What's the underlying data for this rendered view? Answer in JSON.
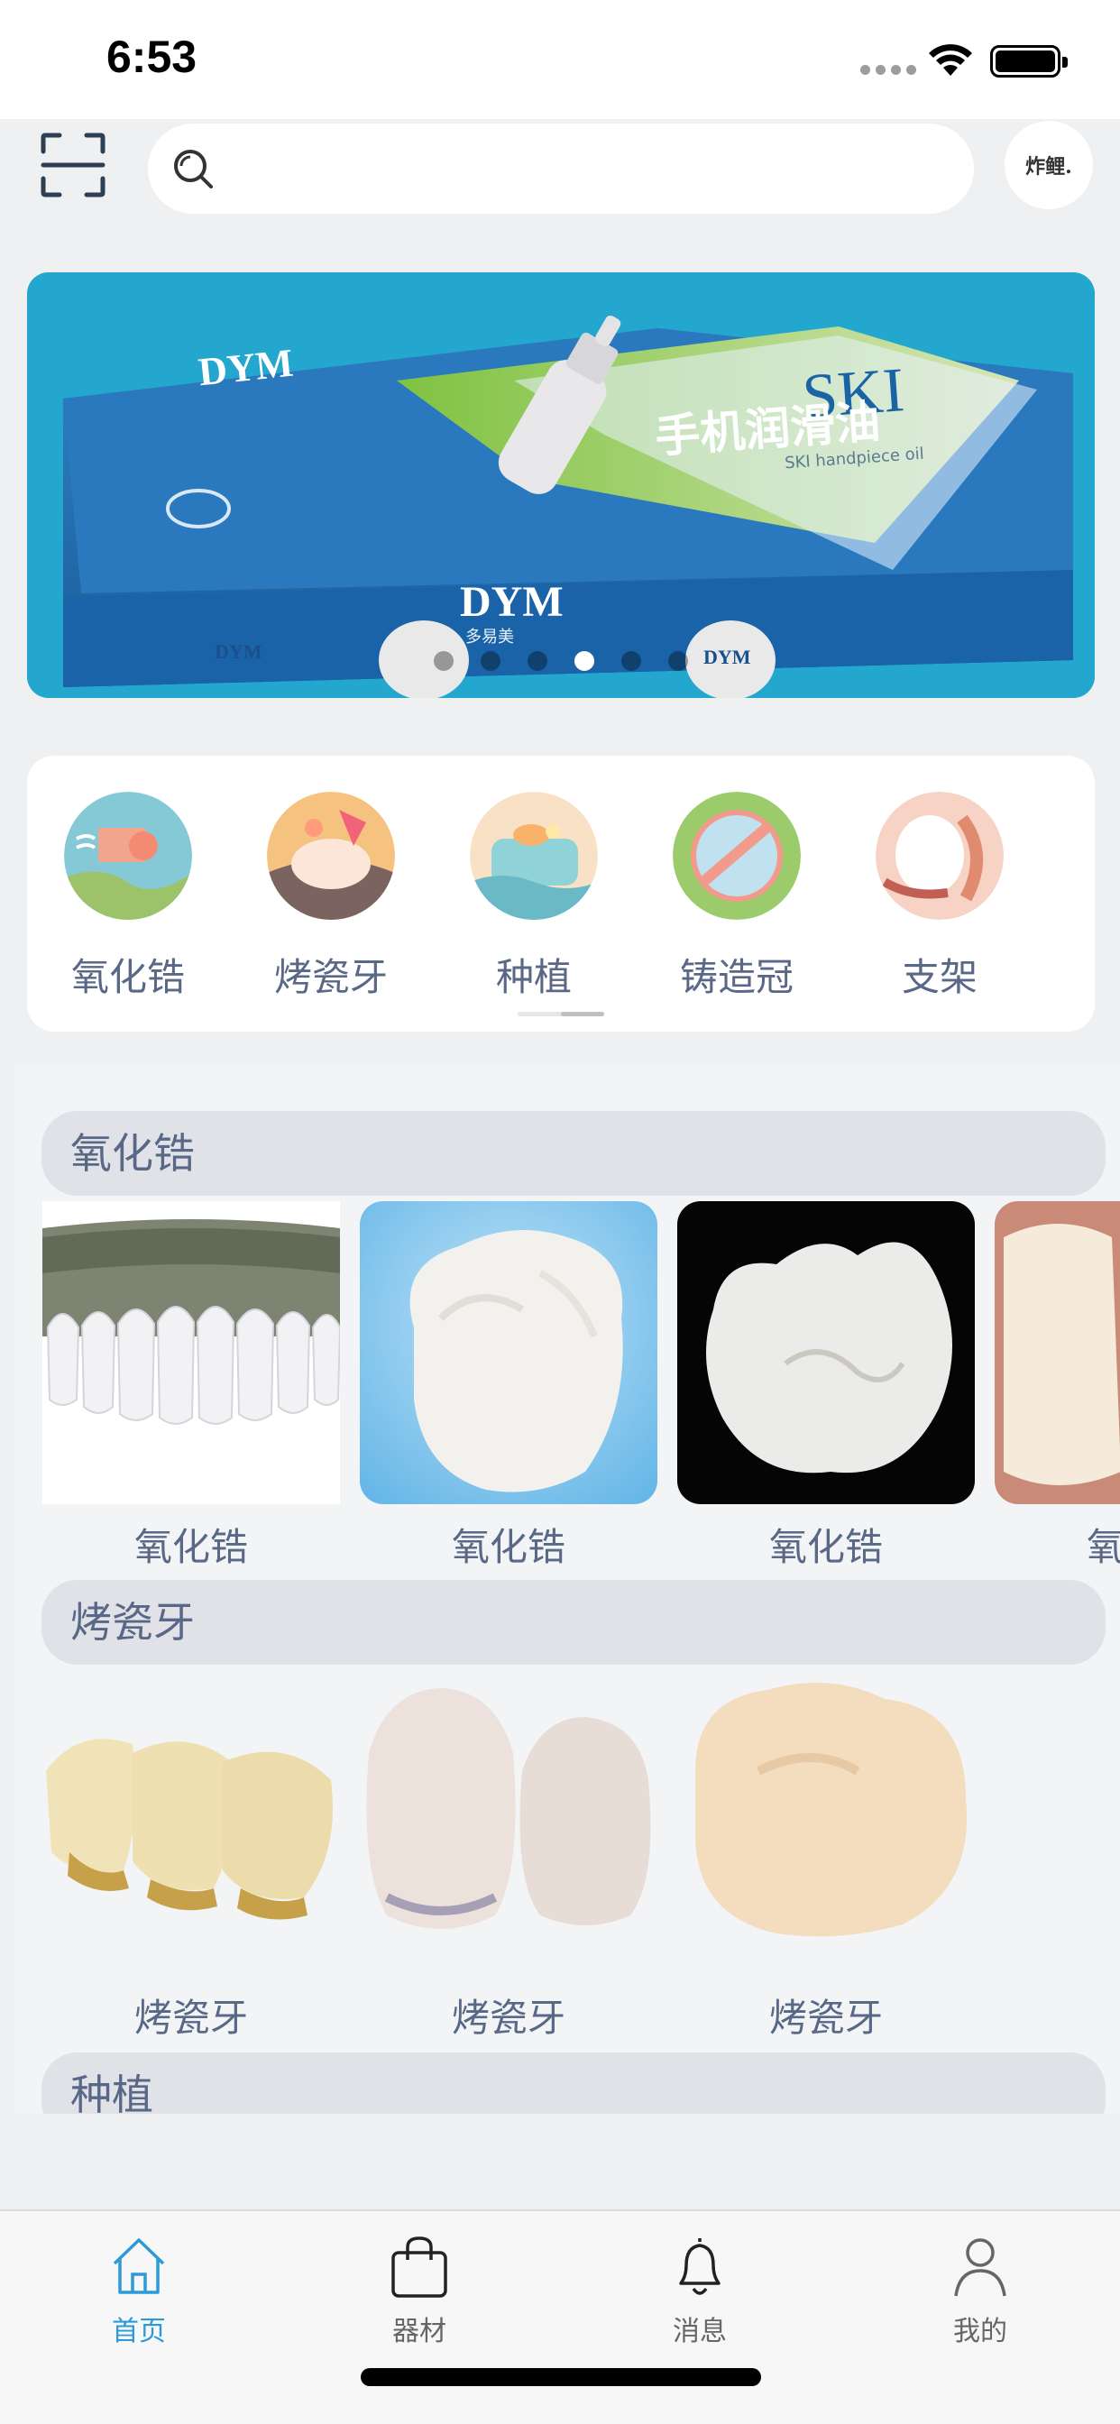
{
  "status_bar": {
    "time": "6:53"
  },
  "header": {
    "avatar_text": "炸鲤."
  },
  "banner": {
    "brand": "DYM",
    "brand_sub": "多易美",
    "product_en": "SKI",
    "product_cn": "手机润滑油",
    "product_tagline": "SKI handpiece oil",
    "dot_count": 6,
    "active_dot": 4
  },
  "categories": [
    {
      "label": "氧化锆",
      "icon": "zirconia-icon"
    },
    {
      "label": "烤瓷牙",
      "icon": "porcelain-teeth-icon"
    },
    {
      "label": "种植",
      "icon": "implant-icon"
    },
    {
      "label": "铸造冠",
      "icon": "cast-crown-icon"
    },
    {
      "label": "支架",
      "icon": "bracket-icon"
    }
  ],
  "sections": [
    {
      "title": "氧化锆",
      "items": [
        {
          "label": "氧化锆"
        },
        {
          "label": "氧化锆"
        },
        {
          "label": "氧化锆"
        },
        {
          "label": "氧化锆"
        }
      ]
    },
    {
      "title": "烤瓷牙",
      "items": [
        {
          "label": "烤瓷牙"
        },
        {
          "label": "烤瓷牙"
        },
        {
          "label": "烤瓷牙"
        }
      ]
    },
    {
      "title": "种植",
      "items": []
    }
  ],
  "tabbar": {
    "tabs": [
      {
        "label": "首页",
        "icon": "home-icon",
        "active": true
      },
      {
        "label": "器材",
        "icon": "bag-icon",
        "active": false
      },
      {
        "label": "消息",
        "icon": "bell-icon",
        "active": false
      },
      {
        "label": "我的",
        "icon": "person-icon",
        "active": false
      }
    ]
  },
  "colors": {
    "accent": "#2d9ad8",
    "label": "#596886",
    "section_bg": "#e1e2e7",
    "banner_bg": "#23a7cf"
  }
}
